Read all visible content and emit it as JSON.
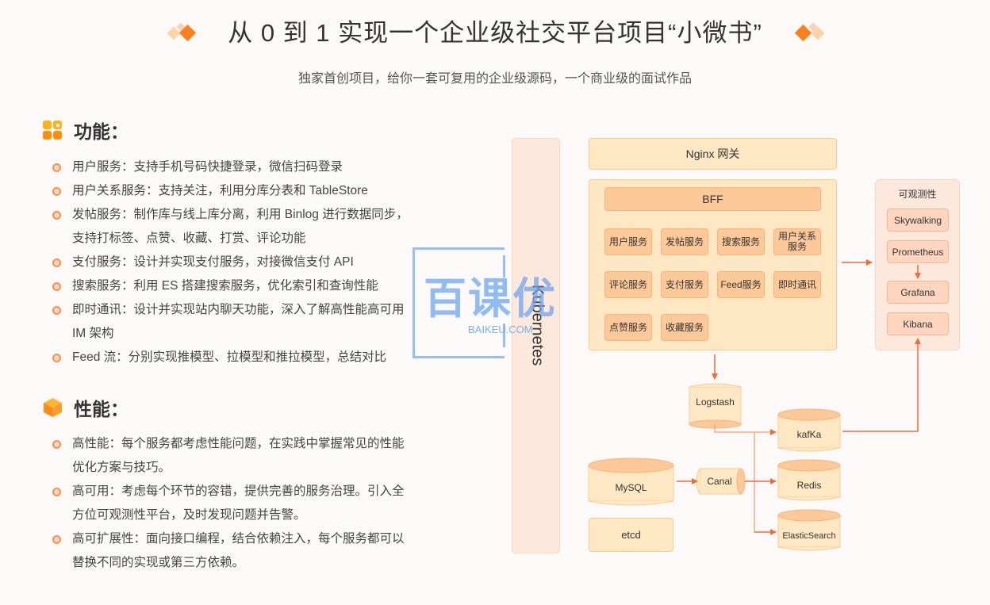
{
  "header": {
    "title": "从 0 到 1 实现一个企业级社交平台项目“小微书”",
    "subtitle": "独家首创项目，给你一套可复用的企业级源码，一个商业级的面试作品"
  },
  "colors": {
    "accent": "#ff7f1a",
    "accent_light": "#ffd3a8",
    "accent_pale": "#fbd4c0",
    "arrow": "#f26b3a",
    "bg": "#fcfaf9"
  },
  "features": {
    "heading": "功能：",
    "icon": "grid-icon",
    "items": [
      {
        "lines": [
          "用户服务：支持手机号码快捷登录，微信扫码登录"
        ]
      },
      {
        "lines": [
          "用户关系服务：支持关注，利用分库分表和 TableStore"
        ]
      },
      {
        "lines": [
          "发帖服务：制作库与线上库分离，利用 Binlog 进行数据同步，",
          "支持打标签、点赞、收藏、打赏、评论功能"
        ]
      },
      {
        "lines": [
          "支付服务：设计并实现支付服务，对接微信支付 API"
        ]
      },
      {
        "lines": [
          "搜索服务：利用 ES 搭建搜索服务，优化索引和查询性能"
        ]
      },
      {
        "lines": [
          "即时通讯：设计并实现站内聊天功能，深入了解高性能高可用",
          "IM 架构"
        ]
      },
      {
        "lines": [
          "Feed 流：分别实现推模型、拉模型和推拉模型，总结对比"
        ]
      }
    ]
  },
  "performance": {
    "heading": "性能：",
    "icon": "cube-icon",
    "items": [
      {
        "lines": [
          "高性能：每个服务都考虑性能问题，在实践中掌握常见的性能",
          "优化方案与技巧。"
        ]
      },
      {
        "lines": [
          "高可用：考虑每个环节的容错，提供完善的服务治理。引入全",
          "方位可观测性平台，及时发现问题并告警。"
        ]
      },
      {
        "lines": [
          "高可扩展性：面向接口编程，结合依赖注入，每个服务都可以",
          "替换不同的实现或第三方依赖。"
        ]
      }
    ]
  },
  "diagram": {
    "kubernetes": "Kubernetes",
    "gateway": "Nginx 网关",
    "bff": "BFF",
    "services": [
      "用户服务",
      "发帖服务",
      "搜索服务",
      "用户关系服务",
      "评论服务",
      "支付服务",
      "Feed服务",
      "即时通讯",
      "点赞服务",
      "收藏服务"
    ],
    "observability": {
      "title": "可观测性",
      "items": [
        "Skywalking",
        "Prometheus",
        "Grafana",
        "Kibana"
      ]
    },
    "storage": {
      "logstash": "Logstash",
      "kafka": "kafKa",
      "mysql": "MySQL",
      "canal": "Canal",
      "redis": "Redis",
      "elasticsearch": "ElasticSearch",
      "etcd": "etcd"
    }
  },
  "watermark": {
    "text": "百课优",
    "sub": "BAIKEU.COM"
  }
}
